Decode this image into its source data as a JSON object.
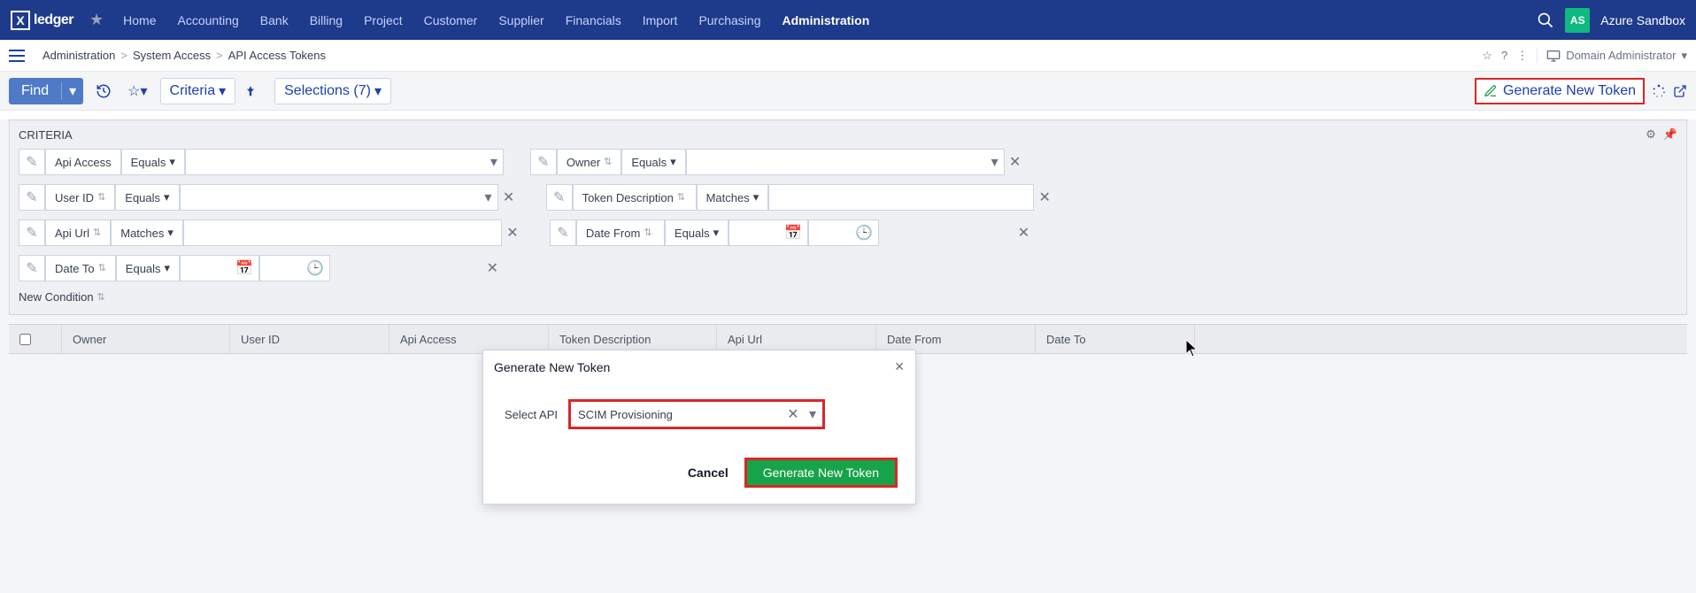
{
  "brand": {
    "icon": "X",
    "name": "ledger"
  },
  "nav": [
    "Home",
    "Accounting",
    "Bank",
    "Billing",
    "Project",
    "Customer",
    "Supplier",
    "Financials",
    "Import",
    "Purchasing",
    "Administration"
  ],
  "nav_active": "Administration",
  "tenant": {
    "initials": "AS",
    "name": "Azure Sandbox"
  },
  "breadcrumb": [
    "Administration",
    "System Access",
    "API Access Tokens"
  ],
  "role_label": "Domain Administrator",
  "toolbar": {
    "find": "Find",
    "criteria": "Criteria",
    "selections": "Selections (7)",
    "generate_token": "Generate New Token"
  },
  "criteria": {
    "title": "CRITERIA",
    "new_condition": "New Condition",
    "ops": {
      "equals": "Equals",
      "matches": "Matches"
    },
    "fields": {
      "api_access": "Api Access",
      "owner": "Owner",
      "user_id": "User ID",
      "token_description": "Token Description",
      "api_url": "Api Url",
      "date_from": "Date From",
      "date_to": "Date To"
    }
  },
  "columns": [
    "Owner",
    "User ID",
    "Api Access",
    "Token Description",
    "Api Url",
    "Date From",
    "Date To"
  ],
  "modal": {
    "title": "Generate New Token",
    "select_label": "Select API",
    "select_value": "SCIM Provisioning",
    "cancel": "Cancel",
    "submit": "Generate New Token"
  }
}
